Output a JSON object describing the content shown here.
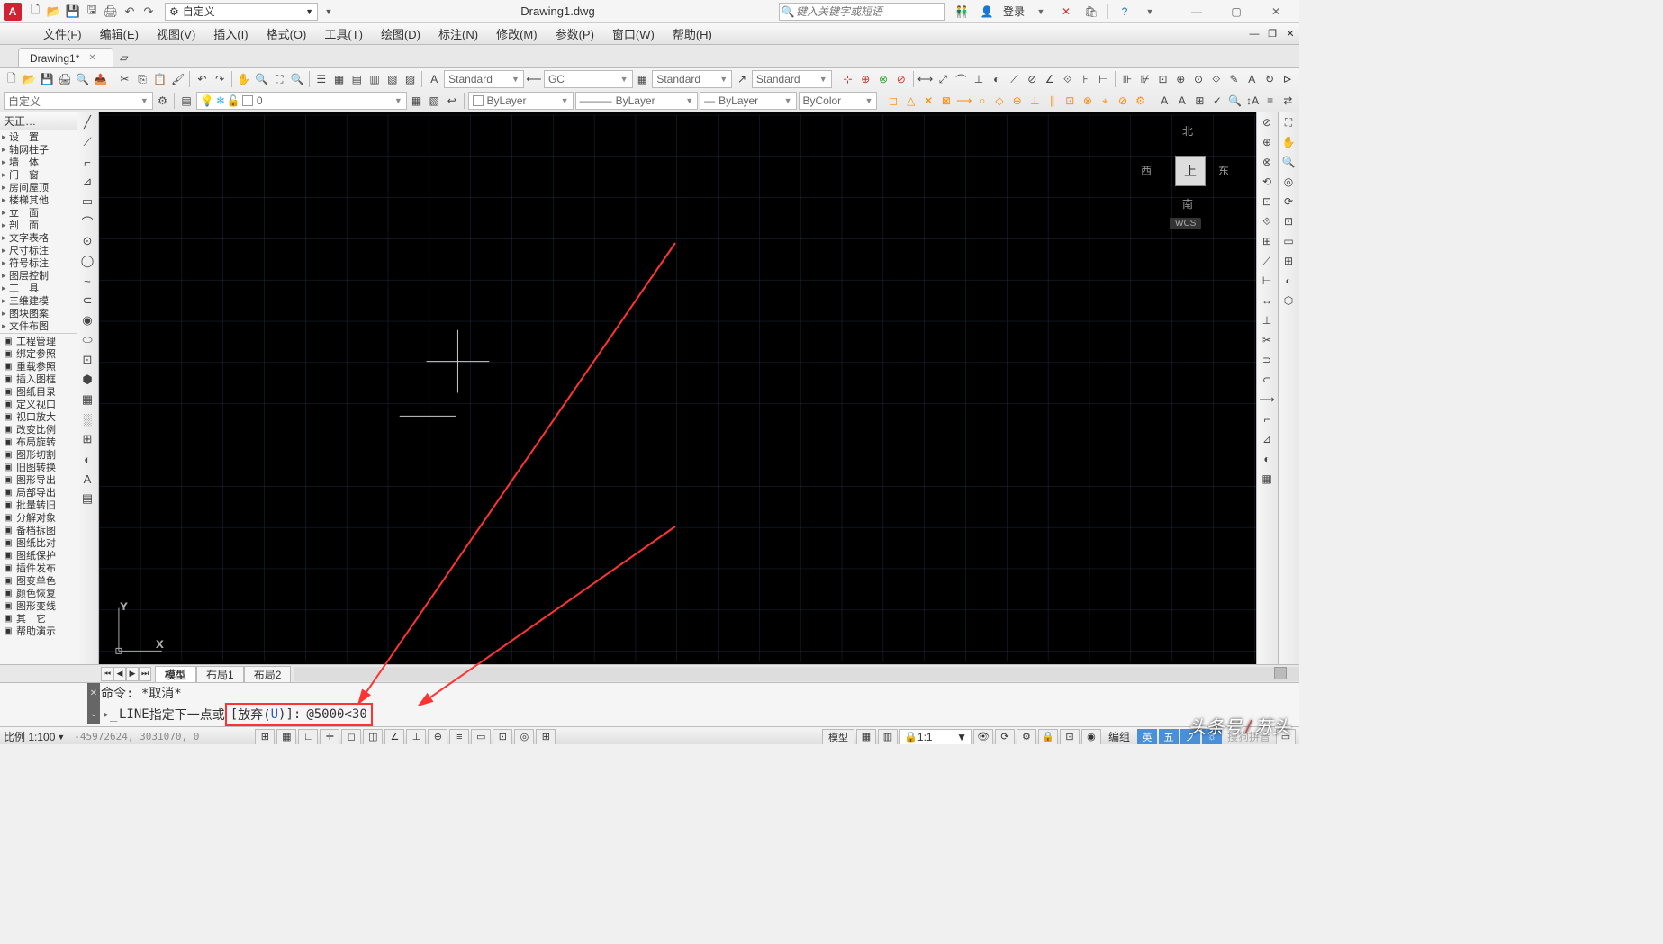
{
  "app": {
    "title": "Drawing1.dwg",
    "qat_mode": "自定义",
    "search_placeholder": "键入关键字或短语",
    "login_label": "登录"
  },
  "menus": [
    "文件(F)",
    "编辑(E)",
    "视图(V)",
    "插入(I)",
    "格式(O)",
    "工具(T)",
    "绘图(D)",
    "标注(N)",
    "修改(M)",
    "参数(P)",
    "窗口(W)",
    "帮助(H)"
  ],
  "doc_tab": {
    "name": "Drawing1*"
  },
  "toolbar": {
    "workspace": "自定义",
    "layer_value": "0",
    "text_style": "Standard",
    "dim_style": "GC",
    "table_style": "Standard",
    "mleader_style": "Standard",
    "layer_color": "ByLayer",
    "line_type": "ByLayer",
    "line_weight": "ByLayer",
    "plot_style": "ByColor"
  },
  "left_panel": {
    "header": "天正…",
    "items_top": [
      "设　置",
      "轴网柱子",
      "墙　体",
      "门　窗",
      "房间屋顶",
      "楼梯其他",
      "立　面",
      "剖　面",
      "文字表格",
      "尺寸标注",
      "符号标注",
      "图层控制",
      "工　具",
      "三维建模",
      "图块图案",
      "文件布图"
    ],
    "items_icon": [
      "工程管理",
      "绑定参照",
      "重载参照",
      "插入图框",
      "图纸目录",
      "定义视口",
      "视口放大",
      "改变比例",
      "布局旋转",
      "图形切割",
      "旧图转换",
      "图形导出",
      "局部导出",
      "批量转旧",
      "分解对象",
      "备档拆图",
      "图纸比对",
      "图纸保护",
      "插件发布",
      "图变单色",
      "颜色恢复",
      "图形变线",
      "其　它",
      "帮助演示"
    ]
  },
  "viewcube": {
    "n": "北",
    "s": "南",
    "e": "东",
    "w": "西",
    "top": "上",
    "wcs": "WCS"
  },
  "layout_tabs": [
    "模型",
    "布局1",
    "布局2"
  ],
  "command": {
    "history": "命令: *取消*",
    "prompt_cmd": "LINE",
    "prompt_text1": " 指定下一点或 ",
    "prompt_bracket_open": "[",
    "prompt_abandon": "放弃(",
    "prompt_u": "U",
    "prompt_abandon_close": ")",
    "prompt_bracket_close": "]: ",
    "input_value": "@5000<30"
  },
  "status": {
    "scale_label": "比例 1:100",
    "coords": "-45972624, 3031070, 0",
    "model_label": "模型",
    "anno_scale": "1:1",
    "lang": "英",
    "ime1": "五",
    "ime2": "ノ",
    "sogou": "搜狗拼音",
    "group": "编组"
  },
  "watermark": {
    "prefix": "头条号",
    "suffix": "苏头"
  }
}
